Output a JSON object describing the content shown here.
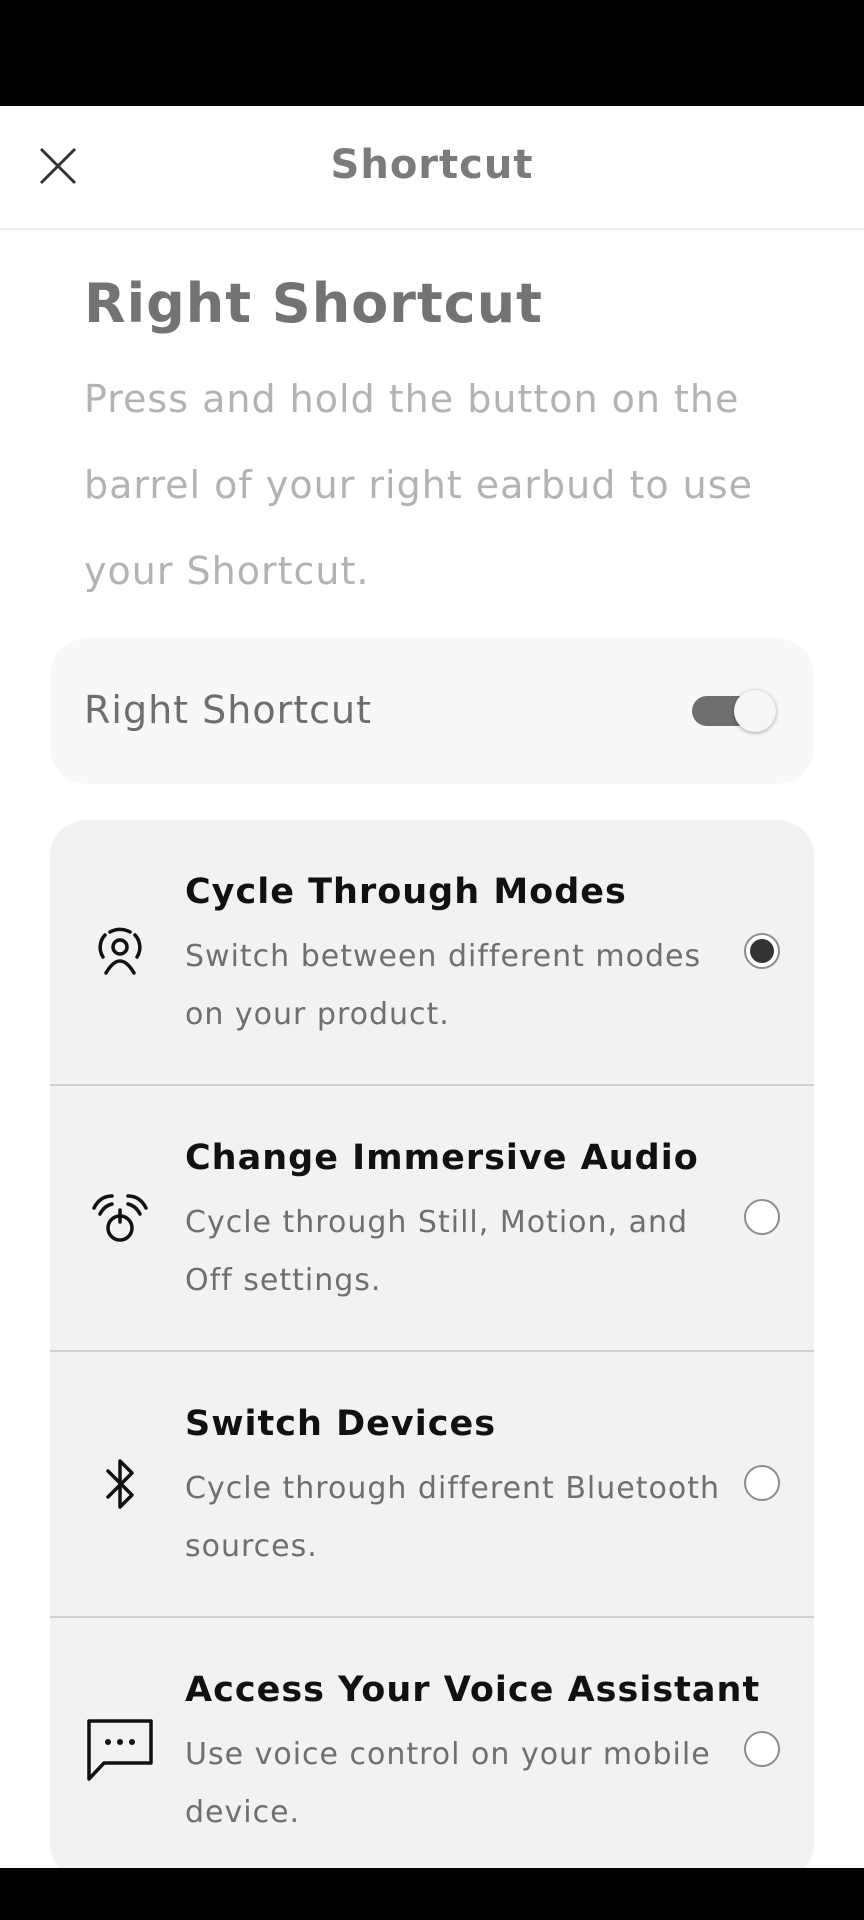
{
  "header": {
    "title": "Shortcut"
  },
  "page": {
    "title": "Right Shortcut",
    "description": "Press and hold the button on the barrel of your right earbud to use your Shortcut."
  },
  "toggle_card": {
    "label": "Right Shortcut",
    "enabled": true
  },
  "options": [
    {
      "title": "Cycle Through Modes",
      "description": "Switch between different modes on your product.",
      "icon": "modes-icon",
      "selected": true
    },
    {
      "title": "Change Immersive Audio",
      "description": "Cycle through Still, Motion, and Off settings.",
      "icon": "immersive-audio-icon",
      "selected": false
    },
    {
      "title": "Switch Devices",
      "description": "Cycle through different Bluetooth sources.",
      "icon": "bluetooth-icon",
      "selected": false
    },
    {
      "title": "Access Your Voice Assistant",
      "description": "Use voice control on your mobile device.",
      "icon": "voice-assistant-icon",
      "selected": false
    }
  ]
}
